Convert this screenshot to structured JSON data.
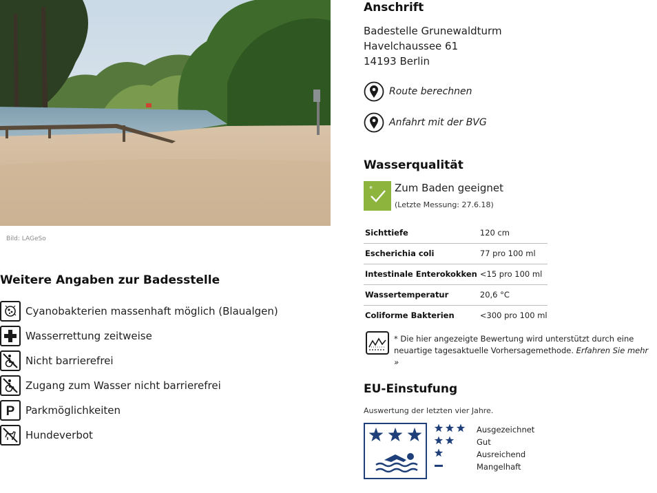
{
  "photo": {
    "credit": "Bild: LAGeSo"
  },
  "address": {
    "heading": "Anschrift",
    "lines": [
      "Badestelle Grunewaldturm",
      "Havelchaussee 61",
      "14193 Berlin"
    ],
    "route_label": "Route berechnen",
    "bvg_label": "Anfahrt mit der BVG"
  },
  "water_quality": {
    "heading": "Wasserqualität",
    "status": "Zum Baden geeignet",
    "last_measurement": "(Letzte Messung: 27.6.18)",
    "rows": [
      {
        "label": "Sichttiefe",
        "value": "120 cm"
      },
      {
        "label": "Escherichia coli",
        "value": "77 pro 100 ml"
      },
      {
        "label": "Intestinale Enterokokken",
        "value": "<15 pro 100 ml"
      },
      {
        "label": "Wassertemperatur",
        "value": "20,6 °C"
      },
      {
        "label": "Coliforme Bakterien",
        "value": "<300 pro 100 ml"
      }
    ],
    "forecast_note": "* Die hier angezeigte Bewertung wird unterstützt durch eine neuartige tagesaktuelle Vorhersagemethode.",
    "forecast_link": "Erfahren Sie mehr »",
    "status_color": "#8db53d"
  },
  "more_info": {
    "heading": "Weitere Angaben zur Badesstelle",
    "items": [
      {
        "icon": "algae-icon",
        "label": "Cyanobakterien massenhaft möglich (Blaualgen)"
      },
      {
        "icon": "first-aid-cross-icon",
        "label": "Wasserrettung zeitweise"
      },
      {
        "icon": "wheelchair-crossed-icon",
        "label": "Nicht barrierefrei"
      },
      {
        "icon": "wheelchair-crossed-icon",
        "label": "Zugang zum Wasser nicht barrierefrei"
      },
      {
        "icon": "parking-icon",
        "label": "Parkmöglichkeiten"
      },
      {
        "icon": "no-dogs-icon",
        "label": "Hundeverbot"
      }
    ]
  },
  "eu_rating": {
    "heading": "EU-Einstufung",
    "subtitle": "Auswertung der letzten vier Jahre.",
    "current_stars": 3,
    "legend": [
      {
        "stars": 3,
        "label": "Ausgezeichnet"
      },
      {
        "stars": 2,
        "label": "Gut"
      },
      {
        "stars": 1,
        "label": "Ausreichend"
      },
      {
        "stars": 0,
        "label": "Mangelhaft"
      }
    ],
    "color": "#1e3f7a"
  }
}
